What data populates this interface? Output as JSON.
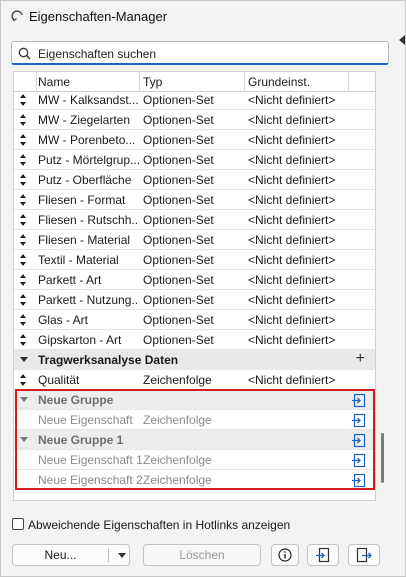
{
  "window": {
    "title": "Eigenschaften-Manager"
  },
  "search": {
    "placeholder": "Eigenschaften suchen"
  },
  "table": {
    "columns": [
      "Name",
      "Typ",
      "Grundeinst."
    ],
    "rows": [
      {
        "name": "MW - Kalksandst...",
        "type": "Optionen-Set",
        "default": "<Nicht definiert>"
      },
      {
        "name": "MW - Ziegelarten",
        "type": "Optionen-Set",
        "default": "<Nicht definiert>"
      },
      {
        "name": "MW - Porenbeto...",
        "type": "Optionen-Set",
        "default": "<Nicht definiert>"
      },
      {
        "name": "Putz - Mörtelgrup...",
        "type": "Optionen-Set",
        "default": "<Nicht definiert>"
      },
      {
        "name": "Putz - Oberfläche",
        "type": "Optionen-Set",
        "default": "<Nicht definiert>"
      },
      {
        "name": "Fliesen - Format",
        "type": "Optionen-Set",
        "default": "<Nicht definiert>"
      },
      {
        "name": "Fliesen - Rutschh...",
        "type": "Optionen-Set",
        "default": "<Nicht definiert>"
      },
      {
        "name": "Fliesen - Material",
        "type": "Optionen-Set",
        "default": "<Nicht definiert>"
      },
      {
        "name": "Textil - Material",
        "type": "Optionen-Set",
        "default": "<Nicht definiert>"
      },
      {
        "name": "Parkett - Art",
        "type": "Optionen-Set",
        "default": "<Nicht definiert>"
      },
      {
        "name": "Parkett - Nutzung...",
        "type": "Optionen-Set",
        "default": "<Nicht definiert>"
      },
      {
        "name": "Glas - Art",
        "type": "Optionen-Set",
        "default": "<Nicht definiert>"
      },
      {
        "name": "Gipskarton - Art",
        "type": "Optionen-Set",
        "default": "<Nicht definiert>"
      }
    ],
    "group_tragwerk": {
      "label": "Tragwerksanalyse Daten",
      "add": "+"
    },
    "qualitaet": {
      "name": "Qualität",
      "type": "Zeichenfolge",
      "default": "<Nicht definiert>"
    },
    "new_group": {
      "label": "Neue Gruppe"
    },
    "new_prop": {
      "name": "Neue Eigenschaft",
      "type": "Zeichenfolge"
    },
    "new_group_1": {
      "label": "Neue Gruppe 1"
    },
    "new_prop_1": {
      "name": "Neue Eigenschaft 1",
      "type": "Zeichenfolge"
    },
    "new_prop_2": {
      "name": "Neue Eigenschaft 2",
      "type": "Zeichenfolge"
    }
  },
  "hotlinks_checkbox": {
    "label": "Abweichende Eigenschaften in Hotlinks anzeigen",
    "checked": false
  },
  "buttons": {
    "new": "Neu...",
    "delete": "Löschen"
  },
  "colors": {
    "accent": "#1f62c4",
    "highlight_border": "#d01c1c",
    "link_icon": "#1f62c4"
  }
}
